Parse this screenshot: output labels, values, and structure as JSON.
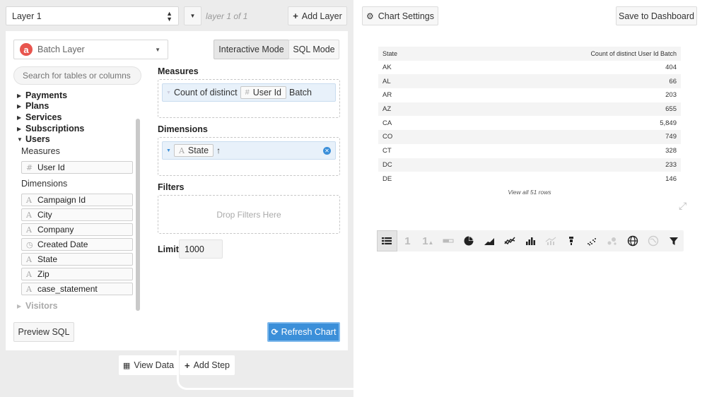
{
  "layer": {
    "select_value": "Layer 1",
    "count_text": "layer 1 of 1",
    "add_label": "Add Layer"
  },
  "chart_settings_label": "Chart Settings",
  "save_dashboard_label": "Save to Dashboard",
  "datasource": {
    "logo_letter": "a",
    "name": "Batch Layer"
  },
  "modes": {
    "interactive": "Interactive Mode",
    "sql": "SQL Mode"
  },
  "search": {
    "placeholder": "Search for tables or columns"
  },
  "tree": {
    "tables": [
      "Payments",
      "Plans",
      "Services",
      "Subscriptions",
      "Users"
    ],
    "measures_label": "Measures",
    "measure_fields": [
      "User Id"
    ],
    "dimensions_label": "Dimensions",
    "dimension_fields": [
      "Campaign Id",
      "City",
      "Company",
      "Created Date",
      "State",
      "Zip",
      "case_statement"
    ],
    "visitors": "Visitors"
  },
  "query": {
    "measures_label": "Measures",
    "measure_prefix": "Count of distinct",
    "measure_field": "User Id",
    "measure_suffix": "Batch",
    "dimensions_label": "Dimensions",
    "dimension_field": "State",
    "dimension_sort": "↑",
    "filters_label": "Filters",
    "filters_drop": "Drop Filters Here",
    "limit_label": "Limit",
    "limit_value": "1000"
  },
  "preview_sql_label": "Preview SQL",
  "refresh_label": "Refresh Chart",
  "view_data_label": "View Data",
  "add_step_label": "Add Step",
  "colors": {
    "accent_blue": "#3b8fd9",
    "logo_red": "#e8554e",
    "pill_bg": "#e8f1fa"
  },
  "chart_data": {
    "type": "table",
    "columns": [
      "State",
      "Count of distinct User Id Batch"
    ],
    "rows": [
      [
        "AK",
        "404"
      ],
      [
        "AL",
        "66"
      ],
      [
        "AR",
        "203"
      ],
      [
        "AZ",
        "655"
      ],
      [
        "CA",
        "5,849"
      ],
      [
        "CO",
        "749"
      ],
      [
        "CT",
        "328"
      ],
      [
        "DC",
        "233"
      ],
      [
        "DE",
        "146"
      ]
    ],
    "footer": "View all 51 rows"
  },
  "viz_types": [
    "table-icon",
    "single-value-icon",
    "single-value-trend-icon",
    "progress-icon",
    "pie-icon",
    "area-icon",
    "line-icon",
    "bar-icon",
    "combo-icon",
    "funnel-icon",
    "scatter-icon",
    "bubble-icon",
    "globe-icon",
    "map-icon",
    "filter-icon"
  ]
}
